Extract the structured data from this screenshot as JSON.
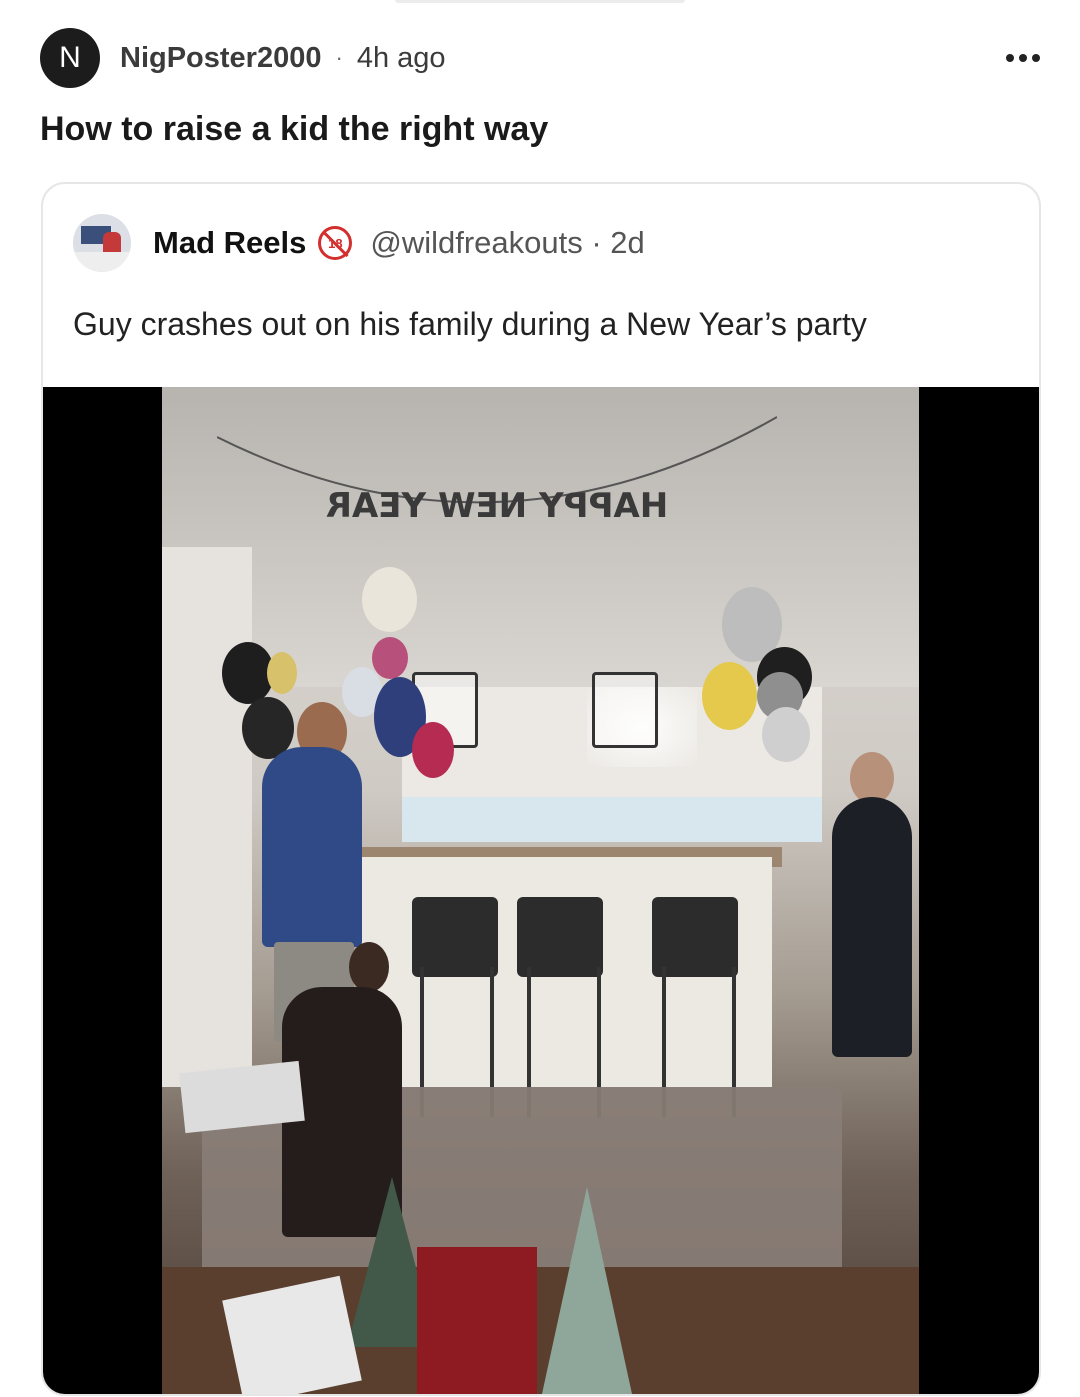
{
  "post": {
    "avatar_letter": "N",
    "username": "NigPoster2000",
    "separator": "·",
    "time_ago": "4h ago",
    "title": "How to raise a kid the right way"
  },
  "embed": {
    "author_name": "Mad Reels",
    "badge_text": "18",
    "handle_time": "@wildfreakouts · 2d",
    "text": "Guy crashes out on his family during a New Year’s party",
    "video": {
      "banner_text": "HAPPY NEW YEAR"
    }
  },
  "colors": {
    "avatar_bg": "#1c1c1c",
    "badge_red": "#d32f2f",
    "video_bg": "#000000"
  }
}
